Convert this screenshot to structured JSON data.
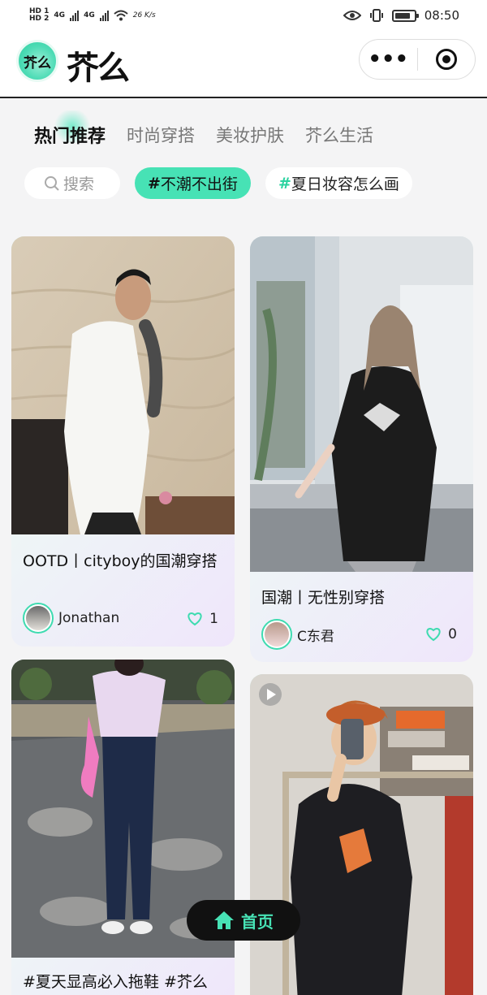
{
  "status_bar": {
    "time": "08:50",
    "hd1": "HD 1",
    "hd2": "HD 2",
    "net1": "4G",
    "net2": "4G",
    "speed": "26 K/s"
  },
  "header": {
    "logo_badge": "芥么",
    "logo_text": "芥么",
    "more_icon": "more-dots-icon",
    "close_icon": "target-icon"
  },
  "tabs": [
    {
      "label": "热门推荐",
      "active": true
    },
    {
      "label": "时尚穿搭",
      "active": false
    },
    {
      "label": "美妆护肤",
      "active": false
    },
    {
      "label": "芥么生活",
      "active": false
    }
  ],
  "search": {
    "placeholder": "搜索"
  },
  "chips": [
    {
      "hash": "#",
      "text": "不潮不出街",
      "active": true
    },
    {
      "hash": "#",
      "text": "夏日妆容怎么画",
      "active": false
    }
  ],
  "cards": [
    {
      "title": "OOTD丨cityboy的国潮穿搭",
      "user": "Jonathan",
      "likes": "1"
    },
    {
      "title": "国潮丨无性别穿搭",
      "user": "C东君",
      "likes": "0"
    },
    {
      "title": "#夏天显高必入拖鞋 #芥么",
      "user": "",
      "likes": ""
    },
    {
      "title": "",
      "user": "",
      "likes": ""
    }
  ],
  "home_button": {
    "label": "首页"
  },
  "colors": {
    "accent": "#47e2b5",
    "background": "#f4f4f5",
    "dark": "#111111"
  }
}
